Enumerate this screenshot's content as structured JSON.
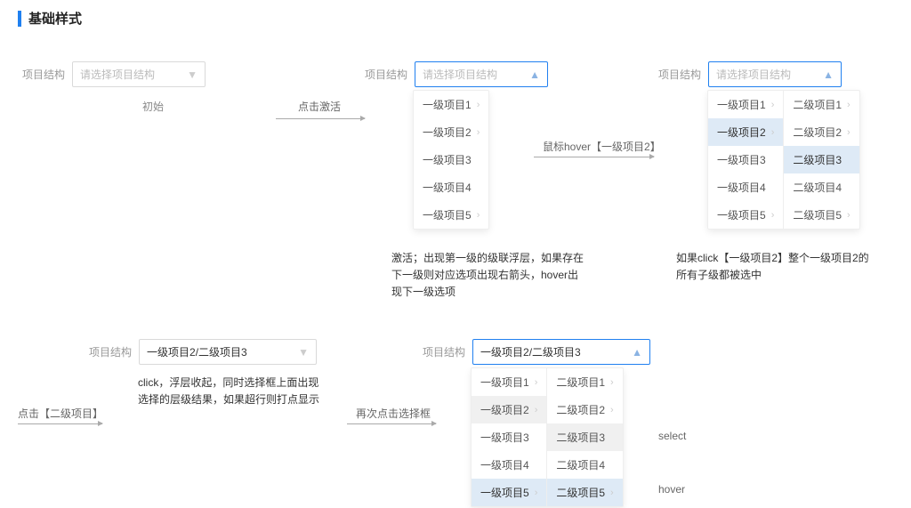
{
  "section": {
    "title": "基础样式"
  },
  "labels": {
    "field": "项目结构",
    "placeholder": "请选择项目结构",
    "selected_value": "一级项目2/二级项目3"
  },
  "state1": {
    "caption": "初始"
  },
  "state2": {
    "transition": "点击激活",
    "items": [
      "一级项目1",
      "一级项目2",
      "一级项目3",
      "一级项目4",
      "一级项目5"
    ],
    "has_arrow": [
      true,
      true,
      false,
      false,
      true
    ],
    "desc": "激活；出现第一级的级联浮层，如果存在下一级则对应选项出现右箭头，hover出现下一级选项"
  },
  "state3": {
    "transition": "鼠标hover【一级项目2】",
    "col1": [
      "一级项目1",
      "一级项目2",
      "一级项目3",
      "一级项目4",
      "一级项目5"
    ],
    "col1_arrow": [
      true,
      true,
      false,
      false,
      true
    ],
    "col2": [
      "二级项目1",
      "二级项目2",
      "二级项目3",
      "二级项目4",
      "二级项目5"
    ],
    "col2_arrow": [
      true,
      true,
      false,
      false,
      true
    ],
    "desc": "如果click【一级项目2】整个一级项目2的所有子级都被选中"
  },
  "state4": {
    "transition": "点击【二级项目】",
    "desc": "click，浮层收起，同时选择框上面出现选择的层级结果，如果超行则打点显示"
  },
  "state5": {
    "transition": "再次点击选择框",
    "col1": [
      "一级项目1",
      "一级项目2",
      "一级项目3",
      "一级项目4",
      "一级项目5"
    ],
    "col1_arrow": [
      true,
      true,
      false,
      false,
      true
    ],
    "col2": [
      "二级项目1",
      "二级项目2",
      "二级项目3",
      "二级项目4",
      "二级项目5"
    ],
    "col2_arrow": [
      true,
      true,
      false,
      false,
      true
    ],
    "select_note": "select",
    "hover_note": "hover"
  }
}
